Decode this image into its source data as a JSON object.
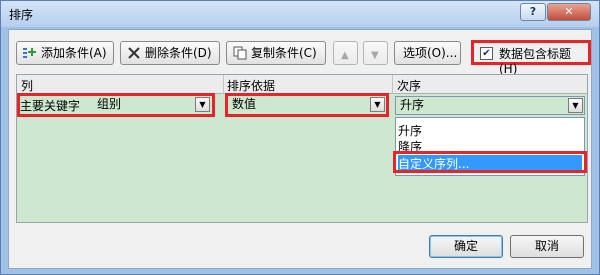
{
  "window": {
    "title": "排序"
  },
  "toolbar": {
    "add_label": "添加条件(A)",
    "delete_label": "删除条件(D)",
    "copy_label": "复制条件(C)",
    "move_up_icon": "triangle-up-icon",
    "move_down_icon": "triangle-down-icon",
    "options_label": "选项(O)...",
    "has_header_label": "数据包含标题(H)",
    "has_header_checked": true
  },
  "grid": {
    "headers": {
      "column": "列",
      "sort_on": "排序依据",
      "order": "次序"
    },
    "row": {
      "label": "主要关键字",
      "column_value": "组别",
      "sort_on_value": "数值",
      "order_value": "升序"
    }
  },
  "order_dropdown": {
    "options": [
      "升序",
      "降序",
      "自定义序列..."
    ],
    "selected_index": 2
  },
  "footer": {
    "ok_label": "确定",
    "cancel_label": "取消"
  },
  "colors": {
    "highlight": "#e8242b",
    "selection": "#3399ff",
    "row_bg": "#cde8cf"
  }
}
